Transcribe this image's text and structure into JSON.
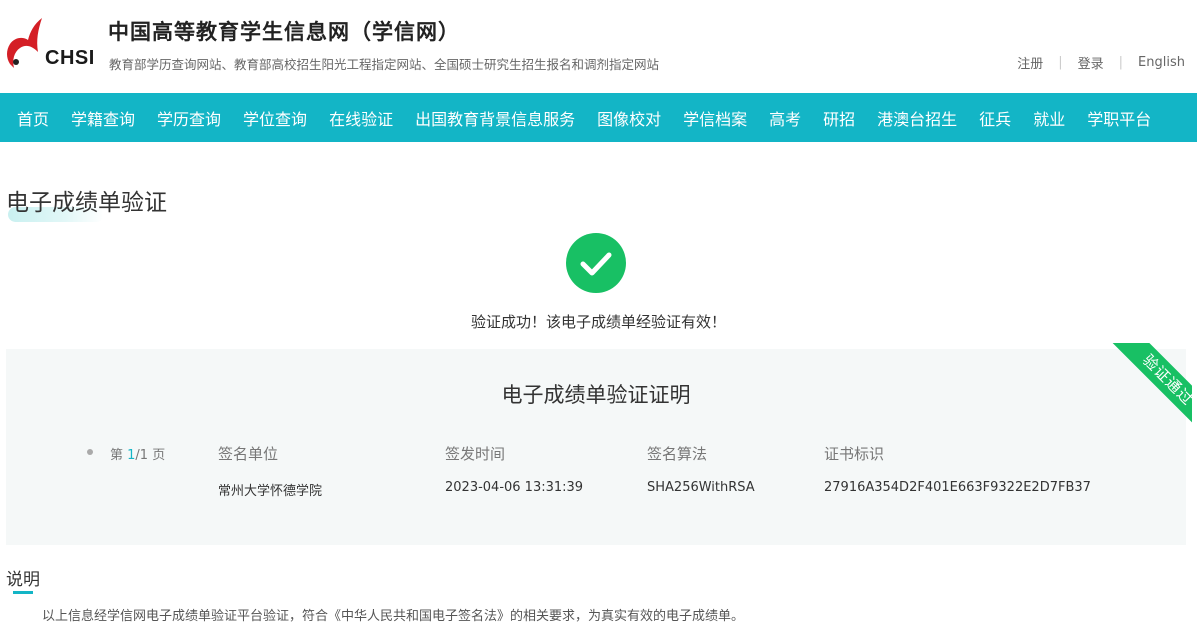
{
  "header": {
    "logo_text": "CHSI",
    "title": "中国高等教育学生信息网（学信网）",
    "subtitle": "教育部学历查询网站、教育部高校招生阳光工程指定网站、全国硕士研究生招生报名和调剂指定网站",
    "links": {
      "register": "注册",
      "login": "登录",
      "english": "English"
    }
  },
  "nav": {
    "items": [
      "首页",
      "学籍查询",
      "学历查询",
      "学位查询",
      "在线验证",
      "出国教育背景信息服务",
      "图像校对",
      "学信档案",
      "高考",
      "研招",
      "港澳台招生",
      "征兵",
      "就业",
      "学职平台"
    ]
  },
  "page": {
    "title": "电子成绩单验证",
    "success_message": "验证成功！该电子成绩单经验证有效！"
  },
  "certificate": {
    "title": "电子成绩单验证证明",
    "ribbon": "验证通过",
    "pager": {
      "prefix": "第 ",
      "current": "1",
      "rest": "/1 页"
    },
    "columns": {
      "signer": {
        "label": "签名单位",
        "value": "常州大学怀德学院"
      },
      "time": {
        "label": "签发时间",
        "value": "2023-04-06 13:31:39"
      },
      "algorithm": {
        "label": "签名算法",
        "value": "SHA256WithRSA"
      },
      "cert_id": {
        "label": "证书标识",
        "value": "27916A354D2F401E663F9322E2D7FB37"
      }
    }
  },
  "notes": {
    "title": "说明",
    "text": "以上信息经学信网电子成绩单验证平台验证，符合《中华人民共和国电子签名法》的相关要求，为真实有效的电子成绩单。"
  },
  "colors": {
    "nav_bg": "#13b5c6",
    "success_green": "#18c064",
    "logo_red": "#d41f26"
  },
  "icons": {
    "logo": "chsi-logo-icon",
    "success": "checkmark-circle-icon"
  }
}
